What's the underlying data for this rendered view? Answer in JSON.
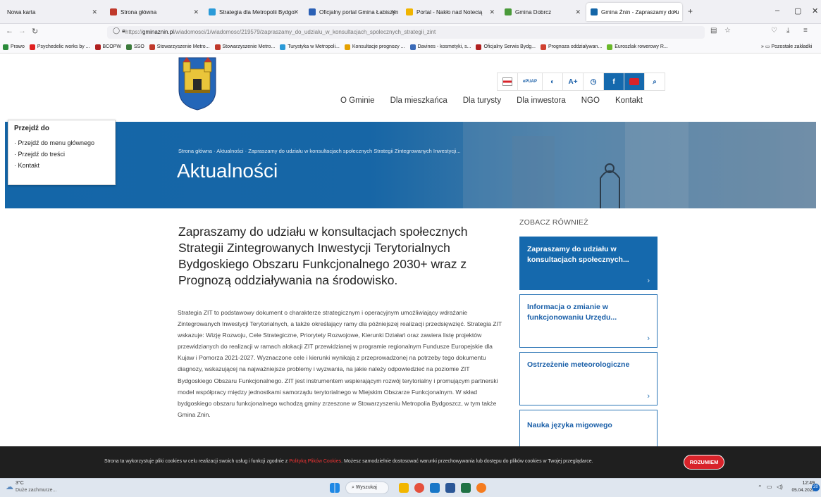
{
  "browser": {
    "tabs": [
      {
        "title": "Nowa karta"
      },
      {
        "title": "Strona główna"
      },
      {
        "title": "Strategia dla Metropolii Bydgo:"
      },
      {
        "title": "Oficjalny portal Gmina Łabiszyn"
      },
      {
        "title": "Portal - Nakło nad Notecią"
      },
      {
        "title": "Gmina Dobrcz"
      },
      {
        "title": "Gmina Żnin - Zapraszamy do u"
      }
    ],
    "new_tab": "+",
    "url_prefix": "https://",
    "url_domain": "gminaznin.pl",
    "url_path": "/wiadomosci/1/wiadomosc/219579/zapraszamy_do_udzialu_w_konsultacjach_spolecznych_strategii_zint",
    "bookmarks": [
      "Prawo",
      "Psychedelic works by ...",
      "BCOPW",
      "SSO",
      "Stowarzyszenie Metro...",
      "Stowarzyszenie Metro...",
      "Turystyka w Metropoli...",
      "Konsultacje prognozy ...",
      "Davines - kosmetyki, s...",
      "Oficjalny Serwis Bydg...",
      "Prognoza oddziaływan...",
      "Euroszlak rowerowy R..."
    ],
    "bookmarks_overflow": "Pozostałe zakładki"
  },
  "site": {
    "nav": [
      "O Gminie",
      "Dla mieszkańca",
      "Dla turysty",
      "Dla inwestora",
      "NGO",
      "Kontakt"
    ],
    "utility": [
      "ePUAP",
      "A+"
    ],
    "skip": {
      "title": "Przejdź do",
      "items": [
        "Przejdź do menu głównego",
        "Przejdź do treści",
        "Kontakt"
      ]
    },
    "breadcrumb": [
      "Strona główna",
      "Aktualności",
      "Zapraszamy do udziału w konsultacjach społecznych Strategii Zintegrowanych Inwestycji..."
    ],
    "hero_title": "Aktualności",
    "article": {
      "title": "Zapraszamy do udziału w konsultacjach społecznych Strategii Zintegrowanych Inwestycji Terytorialnych Bydgoskiego Obszaru Funkcjonalnego 2030+ wraz z Prognozą oddziaływania na środowisko.",
      "body": "Strategia ZIT to podstawowy dokument o charakterze strategicznym i operacyjnym umożliwiający wdrażanie Zintegrowanych Inwestycji Terytorialnych, a także określający ramy dla późniejszej realizacji przedsięwzięć. Strategia ZIT wskazuje: Wizję Rozwoju, Cele Strategiczne, Priorytety Rozwojowe, Kierunki Działań oraz zawiera listę projektów przewidzianych do realizacji w ramach alokacji ZIT przewidzianej w programie regionalnym Fundusze Europejskie dla Kujaw i Pomorza 2021-2027. Wyznaczone cele i kierunki wynikają z przeprowadzonej na potrzeby tego dokumentu diagnozy, wskazującej na najważniejsze problemy i wyzwania, na jakie należy odpowiedzieć na poziomie ZIT Bydgoskiego Obszaru Funkcjonalnego. ZIT jest instrumentem wspierającym rozwój terytorialny i promującym partnerski model współpracy między jednostkami samorządu terytorialnego w Miejskim Obszarze Funkcjonalnym. W skład bydgoskiego obszaru funkcjonalnego wchodzą gminy zrzeszone w Stowarzyszeniu Metropolia Bydgoszcz, w tym także Gmina Żnin."
    },
    "see_also": {
      "title": "ZOBACZ RÓWNIEŻ",
      "cards": [
        "Zapraszamy do udziału w konsultacjach społecznych...",
        "Informacja o zmianie w funkcjonowaniu Urzędu...",
        "Ostrzeżenie meteorologiczne",
        "Nauka języka migowego"
      ]
    },
    "cookie": {
      "text_before": "Strona ta wykorzystuje pliki cookies w celu realizacji swoich usług i funkcji zgodnie z",
      "link": "Polityką Plików Cookies",
      "text_after": ". Możesz samodzielnie dostosować warunki przechowywania lub dostępu do plików cookies w Twojej przeglądarce.",
      "button": "ROZUMIEM"
    }
  },
  "taskbar": {
    "weather_temp": "3°C",
    "weather_desc": "Duże zachmurze...",
    "search": "Wyszukaj",
    "time": "12:49",
    "date": "05.04.2023",
    "badge": "20"
  },
  "colors": {
    "brand": "#1466a8",
    "cookie_button": "#d8232a"
  }
}
